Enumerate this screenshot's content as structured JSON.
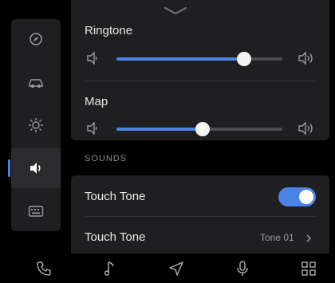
{
  "sidebar": {
    "items": [
      {
        "icon": "compass-icon"
      },
      {
        "icon": "car-icon"
      },
      {
        "icon": "brightness-icon"
      },
      {
        "icon": "volume-icon",
        "active": true
      },
      {
        "icon": "keyboard-icon"
      }
    ]
  },
  "volume": {
    "ringtone": {
      "label": "Ringtone",
      "level": 0.77
    },
    "map": {
      "label": "Map",
      "level": 0.52
    }
  },
  "sounds": {
    "section_title": "SOUNDS",
    "touch_tone_toggle_label": "Touch Tone",
    "touch_tone_toggle_on": true,
    "touch_tone_select_label": "Touch Tone",
    "touch_tone_select_value": "Tone 01"
  },
  "bottom_nav": [
    "phone-icon",
    "music-icon",
    "navigation-icon",
    "microphone-icon",
    "apps-grid-icon"
  ],
  "colors": {
    "accent": "#4a82e6",
    "panel": "#1f1f21",
    "background": "#000000"
  }
}
